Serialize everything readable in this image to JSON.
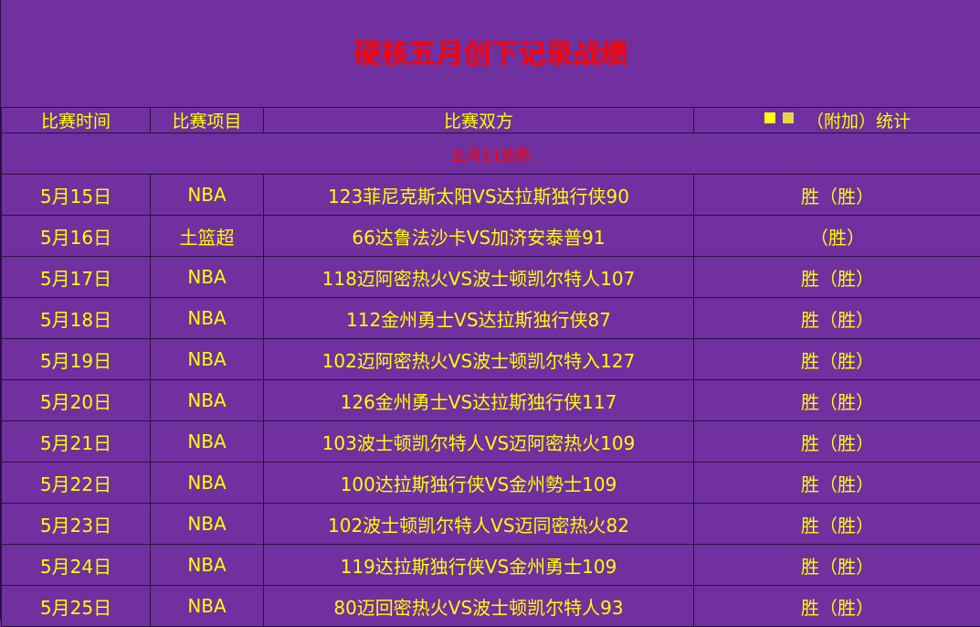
{
  "title": "硬核五月创下记录战绩",
  "header": {
    "date": "比赛时间",
    "event": "比赛项目",
    "matchup": "比赛双方",
    "stat": "（附加）统计"
  },
  "subtitle": "五月11连胜",
  "rows": [
    {
      "date": "5月15日",
      "event": "NBA",
      "matchup": "123菲尼克斯太阳VS达拉斯独行侠90",
      "result": "胜（胜）"
    },
    {
      "date": "5月16日",
      "event": "土篮超",
      "matchup": "66达鲁法沙卡VS加济安泰普91",
      "result": "（胜）"
    },
    {
      "date": "5月17日",
      "event": "NBA",
      "matchup": "118迈阿密热火VS波士顿凯尔特人107",
      "result": "胜（胜）"
    },
    {
      "date": "5月18日",
      "event": "NBA",
      "matchup": "112金州勇士VS达拉斯独行侠87",
      "result": "胜（胜）"
    },
    {
      "date": "5月19日",
      "event": "NBA",
      "matchup": "102迈阿密热火VS波士顿凯尔特入127",
      "result": "胜（胜）"
    },
    {
      "date": "5月20日",
      "event": "NBA",
      "matchup": "126金州勇士VS达拉斯独行侠117",
      "result": "胜（胜）"
    },
    {
      "date": "5月21日",
      "event": "NBA",
      "matchup": "103波士顿凯尔特人VS迈阿密热火109",
      "result": "胜（胜）"
    },
    {
      "date": "5月22日",
      "event": "NBA",
      "matchup": "100达拉斯独行侠VS金州勢士109",
      "result": "胜（胜）"
    },
    {
      "date": "5月23日",
      "event": "NBA",
      "matchup": "102波士顿凯尔特人VS迈同密热火82",
      "result": "胜（胜）"
    },
    {
      "date": "5月24日",
      "event": "NBA",
      "matchup": "119达拉斯独行侠VS金州勇士109",
      "result": "胜（胜）"
    },
    {
      "date": "5月25日",
      "event": "NBA",
      "matchup": "80迈回密热火VS波士顿凯尔特人93",
      "result": "胜（胜）"
    }
  ]
}
